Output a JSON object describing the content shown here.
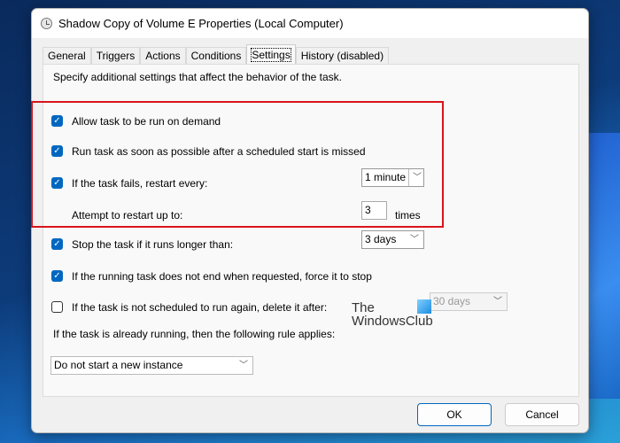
{
  "window": {
    "title": "Shadow Copy of Volume E Properties (Local Computer)"
  },
  "tabs": [
    {
      "label": "General"
    },
    {
      "label": "Triggers"
    },
    {
      "label": "Actions"
    },
    {
      "label": "Conditions"
    },
    {
      "label": "Settings",
      "active": true
    },
    {
      "label": "History (disabled)"
    }
  ],
  "settings": {
    "description": "Specify additional settings that affect the behavior of the task.",
    "allow_on_demand": {
      "label": "Allow task to be run on demand",
      "checked": true
    },
    "run_missed": {
      "label": "Run task as soon as possible after a scheduled start is missed",
      "checked": true
    },
    "restart": {
      "label": "If the task fails, restart every:",
      "checked": true,
      "value": "1 minute"
    },
    "attempts": {
      "label": "Attempt to restart up to:",
      "value": "3",
      "suffix": "times"
    },
    "stop_longer": {
      "label": "Stop the task if it runs longer than:",
      "checked": true,
      "value": "3 days"
    },
    "force_stop": {
      "label": "If the running task does not end when requested, force it to stop",
      "checked": true
    },
    "delete_after": {
      "label": "If the task is not scheduled to run again, delete it after:",
      "checked": false,
      "value": "30 days"
    },
    "rule_label": "If the task is already running, then the following rule applies:",
    "rule_value": "Do not start a new instance"
  },
  "watermark": {
    "line1": "The",
    "line2": "WindowsClub"
  },
  "buttons": {
    "ok": "OK",
    "cancel": "Cancel"
  },
  "colors": {
    "accent": "#0067c0",
    "highlight": "#d9141c"
  }
}
